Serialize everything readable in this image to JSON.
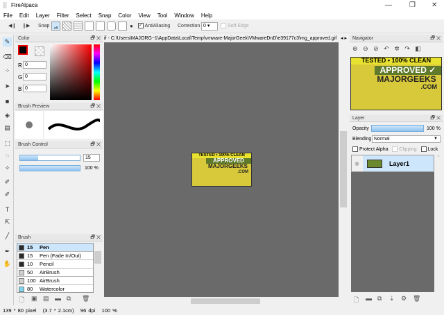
{
  "app": {
    "title": "FireAlpaca"
  },
  "menu": [
    "File",
    "Edit",
    "Layer",
    "Filter",
    "Select",
    "Snap",
    "Color",
    "View",
    "Tool",
    "Window",
    "Help"
  ],
  "toolbar": {
    "snap_label": "Snap",
    "snap_off": "off",
    "antialiasing_label": "AntiAliasing",
    "antialiasing_checked": true,
    "correction_label": "Correction",
    "correction_value": "0",
    "soft_edge_label": "Soft Edge"
  },
  "color_panel": {
    "title": "Color",
    "r_label": "R",
    "r": "0",
    "g_label": "G",
    "g": "0",
    "b_label": "B",
    "b": "0",
    "primary": "#000000",
    "hue": "#ff0000"
  },
  "brush_preview": {
    "title": "Brush Preview"
  },
  "brush_control": {
    "title": "Brush Control",
    "size": "15",
    "opacity": "100 %",
    "size_fraction": 0.3,
    "opacity_fraction": 1.0
  },
  "brush_panel": {
    "title": "Brush",
    "items": [
      {
        "size": "15",
        "name": "Pen",
        "color": "#2a2a2a",
        "selected": true
      },
      {
        "size": "15",
        "name": "Pen (Fade In/Out)",
        "color": "#2a2a2a"
      },
      {
        "size": "10",
        "name": "Pencil",
        "color": "#2a2a2a"
      },
      {
        "size": "50",
        "name": "AirBrush",
        "color": "#d0d0d0"
      },
      {
        "size": "100",
        "name": "AirBrush",
        "color": "#d0d0d0"
      },
      {
        "size": "80",
        "name": "Watercolor",
        "color": "#7fd6f0"
      }
    ]
  },
  "canvas": {
    "tab_title": "if - C:\\Users\\MAJORG~1\\AppData\\Local\\Temp\\vmware-MajorGeek\\VMwareDnD\\e39177c3\\mg_approved.gif",
    "background": "#6a6a6a"
  },
  "logo": {
    "line1": "TESTED • 100% CLEAN",
    "line2": "APPROVED",
    "line3": "MAJORGEEKS",
    "line4": ".COM"
  },
  "navigator": {
    "title": "Navigator"
  },
  "layer_panel": {
    "title": "Layer",
    "opacity_label": "Opacity",
    "opacity": "100 %",
    "opacity_fraction": 1.0,
    "blending_label": "Blending",
    "blending": "Normal",
    "protect_alpha": "Protect Alpha",
    "clipping": "Clipping",
    "lock": "Lock",
    "layers": [
      {
        "name": "Layer1",
        "selected": true
      }
    ]
  },
  "status": {
    "size": "139 * 80 pixel",
    "cm": "(3.7 * 2.1cm)",
    "dpi": "96 dpi",
    "zoom": "100 %"
  }
}
